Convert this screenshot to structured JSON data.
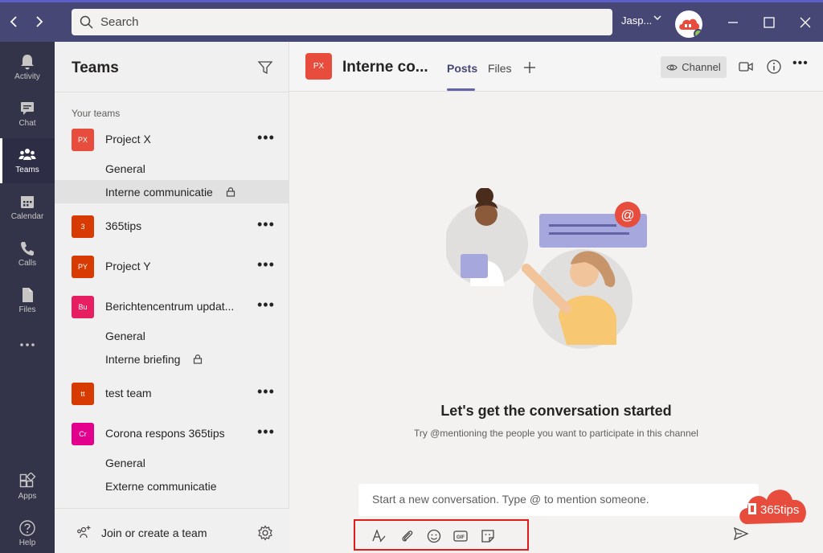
{
  "titlebar": {
    "search_placeholder": "Search",
    "user_name": "Jasp...",
    "back_icon": "chevron-left-icon",
    "forward_icon": "chevron-right-icon"
  },
  "rail": {
    "items": [
      {
        "label": "Activity",
        "icon": "bell-icon"
      },
      {
        "label": "Chat",
        "icon": "chat-icon"
      },
      {
        "label": "Teams",
        "icon": "teams-icon"
      },
      {
        "label": "Calendar",
        "icon": "calendar-icon"
      },
      {
        "label": "Calls",
        "icon": "phone-icon"
      },
      {
        "label": "Files",
        "icon": "file-icon"
      },
      {
        "label": "",
        "icon": "more-icon"
      },
      {
        "label": "Apps",
        "icon": "apps-icon"
      },
      {
        "label": "Help",
        "icon": "help-icon"
      }
    ]
  },
  "panel": {
    "title": "Teams",
    "section_label": "Your teams",
    "teams": [
      {
        "initials": "PX",
        "name": "Project X",
        "color": "#e74c3c",
        "channels": [
          {
            "name": "General"
          },
          {
            "name": "Interne communicatie",
            "private": true,
            "selected": true
          }
        ]
      },
      {
        "initials": "3",
        "name": "365tips",
        "color": "#d83b01",
        "channels": []
      },
      {
        "initials": "PY",
        "name": "Project Y",
        "color": "#d83b01",
        "channels": []
      },
      {
        "initials": "Bu",
        "name": "Berichtencentrum updat...",
        "color": "#e81e63",
        "channels": [
          {
            "name": "General"
          },
          {
            "name": "Interne briefing",
            "private": true
          }
        ]
      },
      {
        "initials": "tt",
        "name": "test team",
        "color": "#d83b01",
        "channels": []
      },
      {
        "initials": "Cr",
        "name": "Corona respons 365tips",
        "color": "#e3008c",
        "channels": [
          {
            "name": "General"
          },
          {
            "name": "Externe communicatie"
          }
        ]
      }
    ],
    "footer_label": "Join or create a team"
  },
  "channel": {
    "initials": "PX",
    "title": "Interne co...",
    "tabs": [
      "Posts",
      "Files"
    ],
    "active_tab": "Posts",
    "channel_button": "Channel"
  },
  "conversation": {
    "title": "Let's get the conversation started",
    "subtitle": "Try @mentioning the people you want to participate in this channel",
    "compose_placeholder": "Start a new conversation. Type @ to mention someone.",
    "toolbar_icons": [
      "format-icon",
      "attach-icon",
      "emoji-icon",
      "gif-icon",
      "sticker-icon"
    ]
  },
  "watermark": {
    "text": "365tips"
  },
  "colors": {
    "titlebar": "#464775",
    "rail": "#33344a",
    "accent": "#6264a7",
    "highlight_box": "#e11c1c"
  }
}
